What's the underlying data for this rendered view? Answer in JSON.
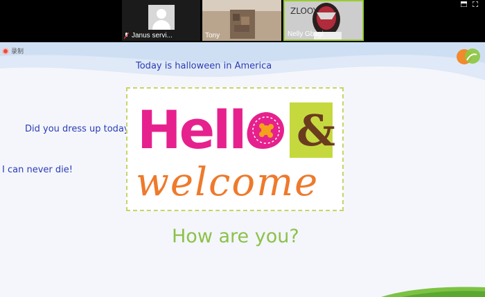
{
  "participants": [
    {
      "name": "Janus servi...",
      "video": "avatar-placeholder",
      "mic": "muted"
    },
    {
      "name": "Tony",
      "video": "camera"
    },
    {
      "name": "Nelly Gbagi",
      "video": "camera",
      "active_speaker": true
    }
  ],
  "window_controls": [
    "layout-icon",
    "fullscreen-icon"
  ],
  "recording": {
    "label": "录制"
  },
  "slide": {
    "messages": [
      "Today is halloween in America",
      "Did you dress up today",
      "I can never die!"
    ],
    "card": {
      "line1": "Hello",
      "amp": "&",
      "line2": "welcome",
      "colors": {
        "hello": "#e6218e",
        "welcome": "#ee7a2c",
        "amp_bg": "#c5d93f",
        "amp": "#6b3b1f",
        "border": "#c7d36a"
      }
    },
    "greeting": "How are you?",
    "colors": {
      "message": "#2a3bb5",
      "greeting": "#8dc14a",
      "background": "#f4f6fb"
    }
  }
}
